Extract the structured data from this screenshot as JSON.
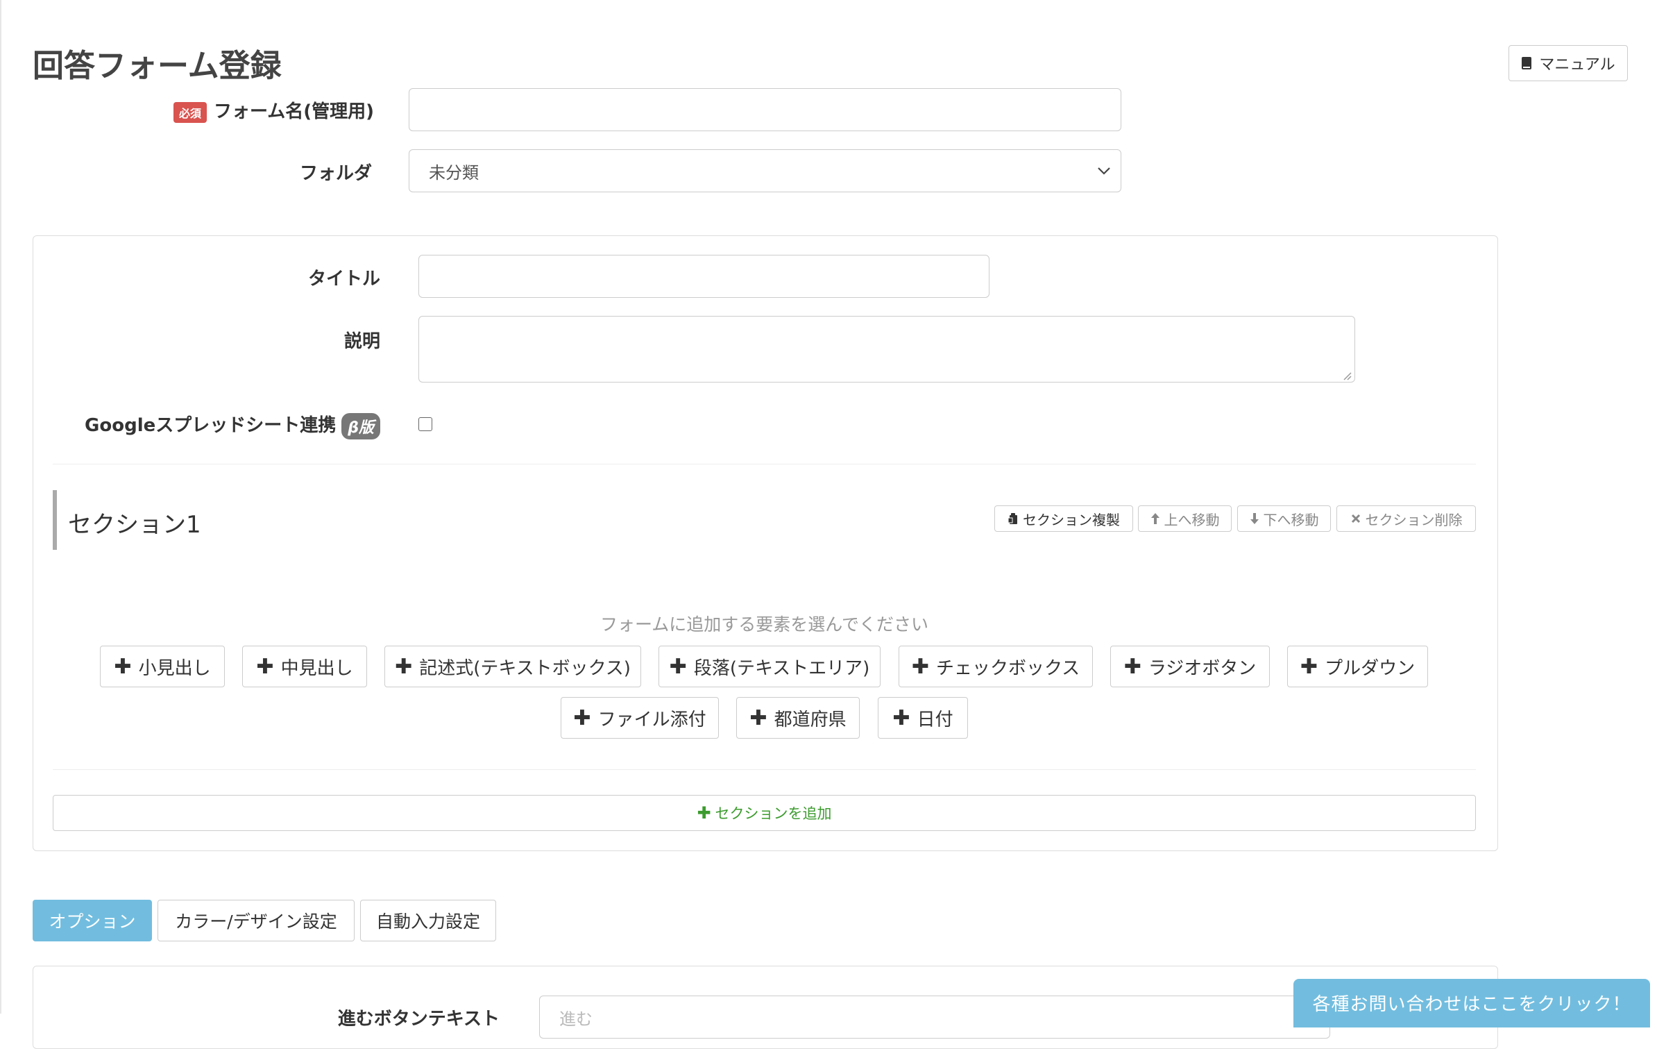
{
  "page": {
    "title": "回答フォーム登録",
    "manual_button": "マニュアル"
  },
  "form": {
    "required_badge": "必須",
    "name_label": "フォーム名(管理用)",
    "name_value": "",
    "folder_label": "フォルダ",
    "folder_selected": "未分類"
  },
  "details": {
    "title_label": "タイトル",
    "title_value": "",
    "description_label": "説明",
    "description_value": "",
    "sheets_label": "Googleスプレッドシート連携",
    "beta_badge": "β版",
    "sheets_checked": false
  },
  "section": {
    "title": "セクション1",
    "actions": {
      "duplicate": "セクション複製",
      "move_up": "上へ移動",
      "move_down": "下へ移動",
      "delete": "セクション削除"
    },
    "hint": "フォームに追加する要素を選んでください",
    "elements": [
      "小見出し",
      "中見出し",
      "記述式(テキストボックス)",
      "段落(テキストエリア)",
      "チェックボックス",
      "ラジオボタン",
      "プルダウン",
      "ファイル添付",
      "都道府県",
      "日付"
    ]
  },
  "add_section_label": "セクションを追加",
  "tabs": [
    "オプション",
    "カラー/デザイン設定",
    "自動入力設定"
  ],
  "options": {
    "next_button_label": "進むボタンテキスト",
    "next_button_placeholder": "進む"
  },
  "support": {
    "label": "各種お問い合わせはここをクリック！"
  },
  "colors": {
    "accent": "#72bddf",
    "required": "#d9534f",
    "add_green": "#3c9b2e"
  },
  "icons": {
    "manual": "book-icon",
    "duplicate": "copy-icon",
    "move_up": "arrow-up-icon",
    "move_down": "arrow-down-icon",
    "delete": "close-icon",
    "add": "plus-icon",
    "select": "chevron-down-icon"
  }
}
